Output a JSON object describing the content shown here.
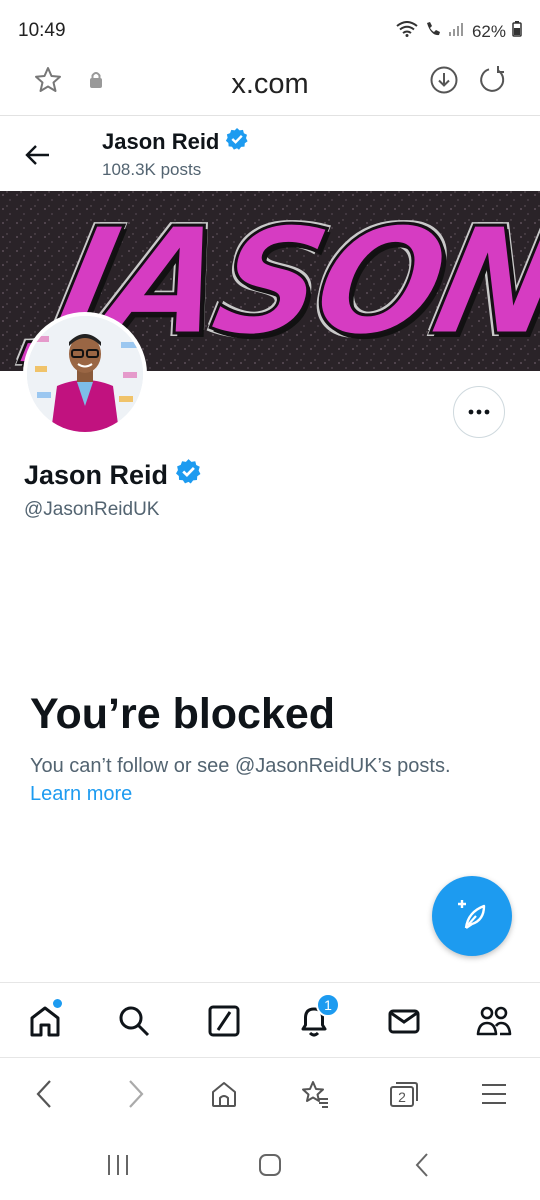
{
  "status_bar": {
    "time": "10:49",
    "battery": "62%"
  },
  "browser": {
    "url": "x.com"
  },
  "header": {
    "name": "Jason Reid",
    "posts": "108.3K posts"
  },
  "banner": {
    "text": "JASON"
  },
  "profile": {
    "display_name": "Jason Reid",
    "handle": "@JasonReidUK"
  },
  "blocked": {
    "title": "You’re blocked",
    "description": "You can’t follow or see @JasonReidUK’s posts.",
    "learn_more": "Learn more"
  },
  "bottom_nav": {
    "items": [
      "home",
      "search",
      "grok",
      "notifications",
      "messages",
      "communities"
    ],
    "notification_count": "1"
  },
  "browser_toolbar": {
    "tabs_count": "2"
  },
  "colors": {
    "accent": "#1d9bf0",
    "text": "#0f1419",
    "secondary": "#536471"
  }
}
